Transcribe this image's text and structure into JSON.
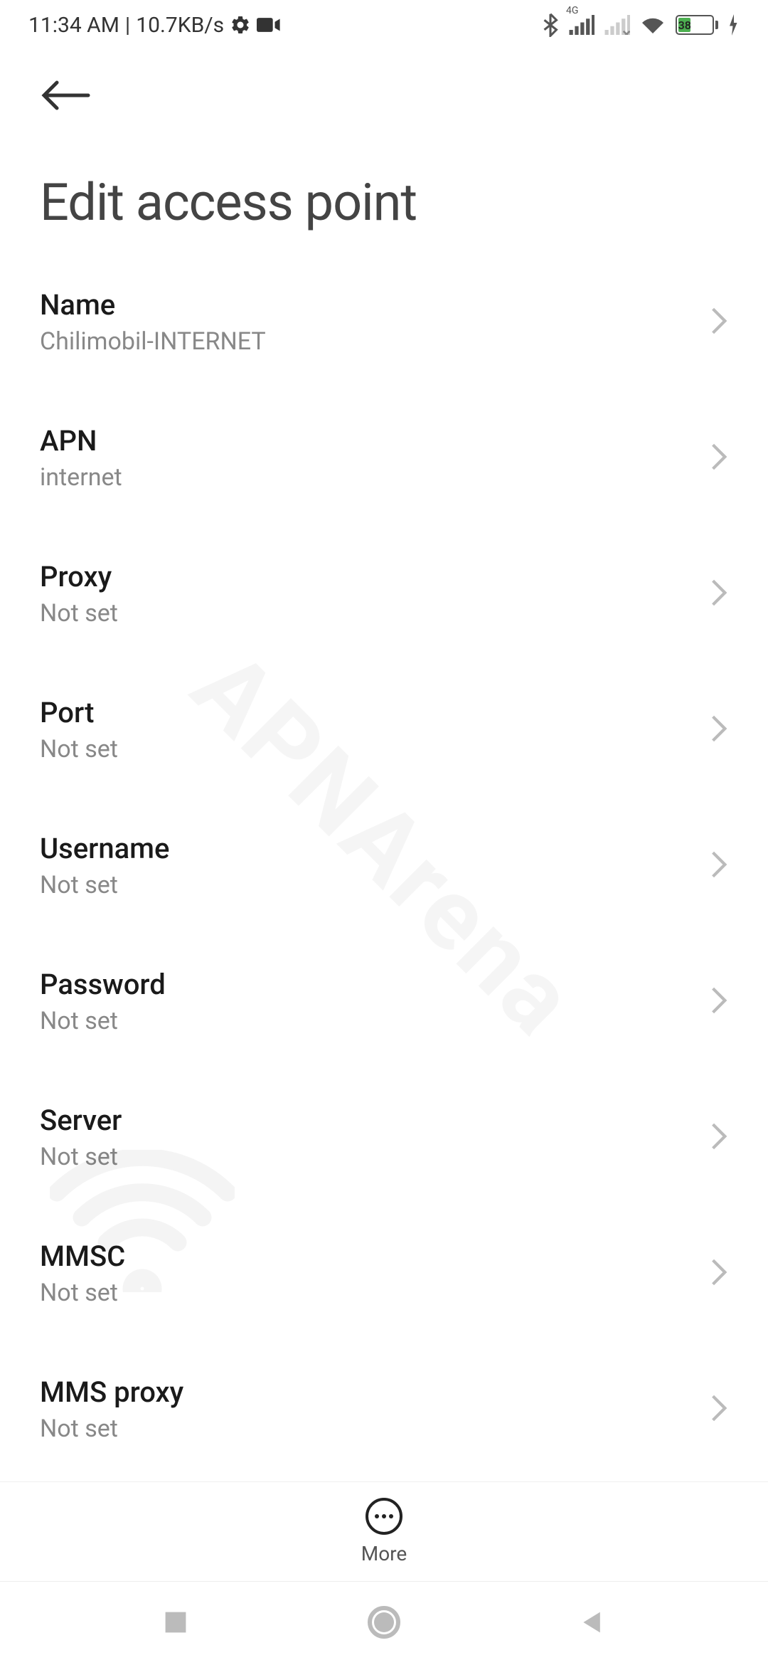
{
  "status": {
    "time": "11:34 AM",
    "speed": "10.7KB/s",
    "network_type": "4G",
    "battery_percent": "38"
  },
  "page_title": "Edit access point",
  "items": [
    {
      "label": "Name",
      "value": "Chilimobil-INTERNET"
    },
    {
      "label": "APN",
      "value": "internet"
    },
    {
      "label": "Proxy",
      "value": "Not set"
    },
    {
      "label": "Port",
      "value": "Not set"
    },
    {
      "label": "Username",
      "value": "Not set"
    },
    {
      "label": "Password",
      "value": "Not set"
    },
    {
      "label": "Server",
      "value": "Not set"
    },
    {
      "label": "MMSC",
      "value": "Not set"
    },
    {
      "label": "MMS proxy",
      "value": "Not set"
    }
  ],
  "bottom": {
    "more_label": "More"
  },
  "watermark": "APNArena"
}
